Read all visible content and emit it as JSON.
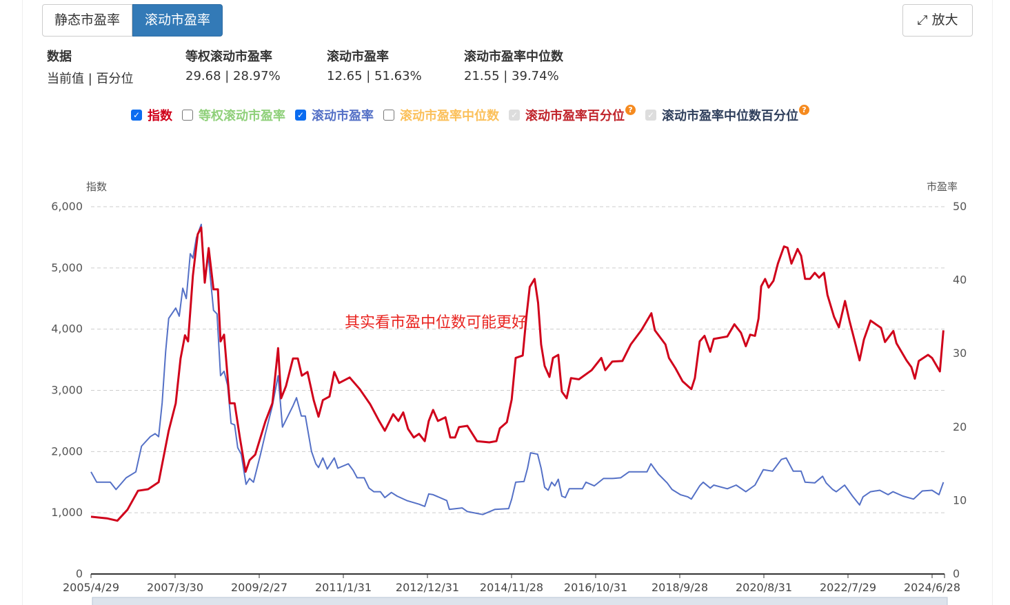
{
  "tabs": [
    "静态市盈率",
    "滚动市盈率"
  ],
  "zoom_label": "放大",
  "stats": [
    {
      "title": "数据",
      "value": "当前值 | 百分位"
    },
    {
      "title": "等权滚动市盈率",
      "value": "29.68 | 28.97%"
    },
    {
      "title": "滚动市盈率",
      "value": "12.65 | 51.63%"
    },
    {
      "title": "滚动市盈率中位数",
      "value": "21.55 | 39.74%"
    }
  ],
  "legend": [
    {
      "label": "指数",
      "state": "checked",
      "color": "#d0021b"
    },
    {
      "label": "等权滚动市盈率",
      "state": "unchecked",
      "color": "#8fd07a"
    },
    {
      "label": "滚动市盈率",
      "state": "checked",
      "color": "#5470c6"
    },
    {
      "label": "滚动市盈率中位数",
      "state": "unchecked",
      "color": "#fbc05a"
    },
    {
      "label": "滚动市盈率百分位",
      "state": "disabled",
      "color": "#c0232a",
      "help": "?"
    },
    {
      "label": "滚动市盈率中位数百分位",
      "state": "disabled",
      "color": "#2f3f5c",
      "help": "?"
    }
  ],
  "annotation": "其实看市盈中位数可能更好",
  "chart_data": {
    "type": "line",
    "y_left": {
      "label": "指数",
      "range": [
        0,
        6000
      ],
      "ticks": [
        "0",
        "1,000",
        "2,000",
        "3,000",
        "4,000",
        "5,000",
        "6,000"
      ]
    },
    "y_right": {
      "label": "市盈率",
      "range": [
        0,
        50
      ],
      "ticks": [
        "0",
        "10",
        "20",
        "30",
        "40",
        "50"
      ]
    },
    "x_ticks": [
      "2005/4/29",
      "2007/3/30",
      "2009/2/27",
      "2011/1/31",
      "2012/12/31",
      "2014/11/28",
      "2016/10/31",
      "2018/9/28",
      "2020/8/31",
      "2022/7/29",
      "2024/6/28"
    ],
    "series": [
      {
        "name": "指数",
        "axis": "left",
        "color": "#d0021b",
        "points": [
          [
            2005.33,
            935
          ],
          [
            2005.69,
            910
          ],
          [
            2005.93,
            870
          ],
          [
            2006.16,
            1050
          ],
          [
            2006.4,
            1360
          ],
          [
            2006.63,
            1385
          ],
          [
            2006.87,
            1500
          ],
          [
            2007.1,
            2340
          ],
          [
            2007.26,
            2790
          ],
          [
            2007.37,
            3520
          ],
          [
            2007.47,
            3900
          ],
          [
            2007.54,
            3800
          ],
          [
            2007.65,
            4875
          ],
          [
            2007.76,
            5550
          ],
          [
            2007.84,
            5660
          ],
          [
            2007.92,
            4760
          ],
          [
            2008.01,
            5325
          ],
          [
            2008.12,
            4650
          ],
          [
            2008.22,
            4650
          ],
          [
            2008.28,
            3800
          ],
          [
            2008.36,
            3910
          ],
          [
            2008.49,
            2790
          ],
          [
            2008.6,
            2790
          ],
          [
            2008.72,
            2230
          ],
          [
            2008.85,
            1670
          ],
          [
            2008.94,
            1860
          ],
          [
            2009.07,
            1950
          ],
          [
            2009.3,
            2490
          ],
          [
            2009.46,
            2790
          ],
          [
            2009.59,
            3690
          ],
          [
            2009.66,
            2870
          ],
          [
            2009.77,
            3070
          ],
          [
            2009.93,
            3520
          ],
          [
            2010.04,
            3520
          ],
          [
            2010.13,
            3240
          ],
          [
            2010.26,
            3300
          ],
          [
            2010.4,
            2840
          ],
          [
            2010.51,
            2570
          ],
          [
            2010.61,
            2840
          ],
          [
            2010.76,
            2900
          ],
          [
            2010.87,
            3300
          ],
          [
            2010.98,
            3120
          ],
          [
            2011.22,
            3210
          ],
          [
            2011.45,
            3020
          ],
          [
            2011.69,
            2770
          ],
          [
            2011.89,
            2500
          ],
          [
            2012.02,
            2340
          ],
          [
            2012.21,
            2610
          ],
          [
            2012.33,
            2500
          ],
          [
            2012.44,
            2640
          ],
          [
            2012.55,
            2370
          ],
          [
            2012.68,
            2230
          ],
          [
            2012.8,
            2290
          ],
          [
            2012.93,
            2170
          ],
          [
            2013.02,
            2500
          ],
          [
            2013.12,
            2680
          ],
          [
            2013.23,
            2500
          ],
          [
            2013.4,
            2560
          ],
          [
            2013.51,
            2230
          ],
          [
            2013.62,
            2230
          ],
          [
            2013.71,
            2400
          ],
          [
            2013.9,
            2420
          ],
          [
            2014.12,
            2170
          ],
          [
            2014.4,
            2150
          ],
          [
            2014.56,
            2170
          ],
          [
            2014.64,
            2380
          ],
          [
            2014.8,
            2480
          ],
          [
            2014.91,
            2850
          ],
          [
            2015.0,
            3530
          ],
          [
            2015.16,
            3570
          ],
          [
            2015.24,
            4180
          ],
          [
            2015.32,
            4690
          ],
          [
            2015.43,
            4820
          ],
          [
            2015.51,
            4430
          ],
          [
            2015.58,
            3750
          ],
          [
            2015.66,
            3400
          ],
          [
            2015.77,
            3220
          ],
          [
            2015.85,
            3530
          ],
          [
            2015.97,
            3580
          ],
          [
            2016.05,
            2980
          ],
          [
            2016.16,
            2870
          ],
          [
            2016.26,
            3200
          ],
          [
            2016.44,
            3180
          ],
          [
            2016.73,
            3330
          ],
          [
            2016.95,
            3530
          ],
          [
            2017.04,
            3330
          ],
          [
            2017.2,
            3470
          ],
          [
            2017.43,
            3480
          ],
          [
            2017.62,
            3750
          ],
          [
            2017.86,
            3980
          ],
          [
            2018.09,
            4260
          ],
          [
            2018.17,
            3980
          ],
          [
            2018.41,
            3750
          ],
          [
            2018.49,
            3530
          ],
          [
            2018.64,
            3360
          ],
          [
            2018.8,
            3150
          ],
          [
            2019.0,
            3020
          ],
          [
            2019.08,
            3200
          ],
          [
            2019.19,
            3800
          ],
          [
            2019.3,
            3890
          ],
          [
            2019.43,
            3630
          ],
          [
            2019.51,
            3840
          ],
          [
            2019.82,
            3880
          ],
          [
            2019.98,
            4080
          ],
          [
            2020.13,
            3940
          ],
          [
            2020.24,
            3720
          ],
          [
            2020.34,
            3910
          ],
          [
            2020.45,
            3890
          ],
          [
            2020.53,
            4170
          ],
          [
            2020.59,
            4700
          ],
          [
            2020.68,
            4820
          ],
          [
            2020.76,
            4680
          ],
          [
            2020.87,
            4790
          ],
          [
            2020.97,
            5070
          ],
          [
            2021.11,
            5350
          ],
          [
            2021.19,
            5330
          ],
          [
            2021.28,
            5070
          ],
          [
            2021.42,
            5310
          ],
          [
            2021.5,
            5200
          ],
          [
            2021.59,
            4820
          ],
          [
            2021.7,
            4820
          ],
          [
            2021.81,
            4920
          ],
          [
            2021.91,
            4840
          ],
          [
            2022.02,
            4920
          ],
          [
            2022.1,
            4560
          ],
          [
            2022.25,
            4200
          ],
          [
            2022.36,
            4030
          ],
          [
            2022.5,
            4460
          ],
          [
            2022.6,
            4140
          ],
          [
            2022.75,
            3720
          ],
          [
            2022.83,
            3490
          ],
          [
            2022.93,
            3830
          ],
          [
            2023.08,
            4140
          ],
          [
            2023.32,
            4020
          ],
          [
            2023.41,
            3790
          ],
          [
            2023.6,
            3970
          ],
          [
            2023.67,
            3770
          ],
          [
            2023.9,
            3490
          ],
          [
            2024.01,
            3380
          ],
          [
            2024.09,
            3190
          ],
          [
            2024.18,
            3480
          ],
          [
            2024.39,
            3580
          ],
          [
            2024.48,
            3530
          ],
          [
            2024.66,
            3310
          ],
          [
            2024.74,
            3980
          ]
        ]
      },
      {
        "name": "滚动市盈率",
        "axis": "right",
        "color": "#5470c6",
        "points": [
          [
            2005.33,
            13.9
          ],
          [
            2005.46,
            12.5
          ],
          [
            2005.77,
            12.5
          ],
          [
            2005.9,
            11.5
          ],
          [
            2006.13,
            13.1
          ],
          [
            2006.35,
            13.9
          ],
          [
            2006.48,
            17.4
          ],
          [
            2006.68,
            18.7
          ],
          [
            2006.79,
            19.1
          ],
          [
            2006.87,
            18.7
          ],
          [
            2006.95,
            23.3
          ],
          [
            2007.03,
            30.3
          ],
          [
            2007.1,
            34.8
          ],
          [
            2007.26,
            36.2
          ],
          [
            2007.34,
            35.1
          ],
          [
            2007.42,
            38.9
          ],
          [
            2007.5,
            37.5
          ],
          [
            2007.59,
            43.6
          ],
          [
            2007.65,
            43.0
          ],
          [
            2007.73,
            45.8
          ],
          [
            2007.84,
            47.6
          ],
          [
            2007.92,
            40.1
          ],
          [
            2008.0,
            43.3
          ],
          [
            2008.12,
            35.9
          ],
          [
            2008.2,
            35.4
          ],
          [
            2008.28,
            27.0
          ],
          [
            2008.36,
            27.6
          ],
          [
            2008.44,
            25.7
          ],
          [
            2008.52,
            20.5
          ],
          [
            2008.6,
            20.3
          ],
          [
            2008.67,
            17.2
          ],
          [
            2008.75,
            16.3
          ],
          [
            2008.86,
            12.2
          ],
          [
            2008.94,
            13.0
          ],
          [
            2009.03,
            12.5
          ],
          [
            2009.19,
            16.3
          ],
          [
            2009.3,
            19.1
          ],
          [
            2009.46,
            22.9
          ],
          [
            2009.59,
            27.0
          ],
          [
            2009.69,
            20.0
          ],
          [
            2009.93,
            22.9
          ],
          [
            2010.01,
            24.0
          ],
          [
            2010.12,
            21.5
          ],
          [
            2010.21,
            21.5
          ],
          [
            2010.35,
            16.7
          ],
          [
            2010.45,
            15.0
          ],
          [
            2010.51,
            14.5
          ],
          [
            2010.61,
            15.8
          ],
          [
            2010.71,
            14.3
          ],
          [
            2010.87,
            15.8
          ],
          [
            2010.95,
            14.4
          ],
          [
            2011.19,
            15.0
          ],
          [
            2011.3,
            14.1
          ],
          [
            2011.39,
            13.1
          ],
          [
            2011.55,
            13.1
          ],
          [
            2011.66,
            11.7
          ],
          [
            2011.77,
            11.2
          ],
          [
            2011.92,
            11.2
          ],
          [
            2012.02,
            10.4
          ],
          [
            2012.17,
            11.1
          ],
          [
            2012.3,
            10.6
          ],
          [
            2012.52,
            10.0
          ],
          [
            2012.8,
            9.5
          ],
          [
            2012.93,
            9.2
          ],
          [
            2013.02,
            10.9
          ],
          [
            2013.12,
            10.8
          ],
          [
            2013.43,
            10.0
          ],
          [
            2013.49,
            8.8
          ],
          [
            2013.78,
            9.0
          ],
          [
            2013.9,
            8.5
          ],
          [
            2014.25,
            8.1
          ],
          [
            2014.53,
            8.8
          ],
          [
            2014.84,
            8.9
          ],
          [
            2014.91,
            10.2
          ],
          [
            2015.0,
            12.5
          ],
          [
            2015.19,
            12.6
          ],
          [
            2015.27,
            14.4
          ],
          [
            2015.34,
            16.5
          ],
          [
            2015.5,
            16.3
          ],
          [
            2015.58,
            14.4
          ],
          [
            2015.66,
            11.8
          ],
          [
            2015.74,
            11.4
          ],
          [
            2015.82,
            12.5
          ],
          [
            2015.89,
            12.0
          ],
          [
            2015.97,
            12.9
          ],
          [
            2016.05,
            10.6
          ],
          [
            2016.13,
            10.4
          ],
          [
            2016.22,
            11.6
          ],
          [
            2016.52,
            11.6
          ],
          [
            2016.6,
            12.5
          ],
          [
            2016.79,
            12.0
          ],
          [
            2017.0,
            13.0
          ],
          [
            2017.2,
            13.0
          ],
          [
            2017.39,
            13.1
          ],
          [
            2017.58,
            13.9
          ],
          [
            2017.99,
            13.9
          ],
          [
            2018.08,
            15.0
          ],
          [
            2018.25,
            13.6
          ],
          [
            2018.45,
            12.4
          ],
          [
            2018.56,
            11.5
          ],
          [
            2018.75,
            10.8
          ],
          [
            2018.92,
            10.5
          ],
          [
            2019.0,
            10.2
          ],
          [
            2019.19,
            12.0
          ],
          [
            2019.27,
            12.5
          ],
          [
            2019.43,
            11.7
          ],
          [
            2019.51,
            12.1
          ],
          [
            2019.82,
            11.6
          ],
          [
            2020.02,
            12.1
          ],
          [
            2020.24,
            11.2
          ],
          [
            2020.45,
            12.1
          ],
          [
            2020.64,
            14.2
          ],
          [
            2020.85,
            14.0
          ],
          [
            2021.05,
            15.6
          ],
          [
            2021.16,
            15.8
          ],
          [
            2021.32,
            14.0
          ],
          [
            2021.5,
            14.0
          ],
          [
            2021.59,
            12.5
          ],
          [
            2021.81,
            12.4
          ],
          [
            2021.99,
            13.3
          ],
          [
            2022.07,
            12.4
          ],
          [
            2022.22,
            11.5
          ],
          [
            2022.3,
            11.2
          ],
          [
            2022.49,
            12.1
          ],
          [
            2022.67,
            10.6
          ],
          [
            2022.83,
            9.4
          ],
          [
            2022.91,
            10.5
          ],
          [
            2023.08,
            11.2
          ],
          [
            2023.29,
            11.4
          ],
          [
            2023.48,
            10.8
          ],
          [
            2023.59,
            11.2
          ],
          [
            2023.82,
            10.6
          ],
          [
            2024.06,
            10.2
          ],
          [
            2024.26,
            11.3
          ],
          [
            2024.48,
            11.4
          ],
          [
            2024.64,
            10.8
          ],
          [
            2024.74,
            12.5
          ]
        ]
      }
    ]
  }
}
